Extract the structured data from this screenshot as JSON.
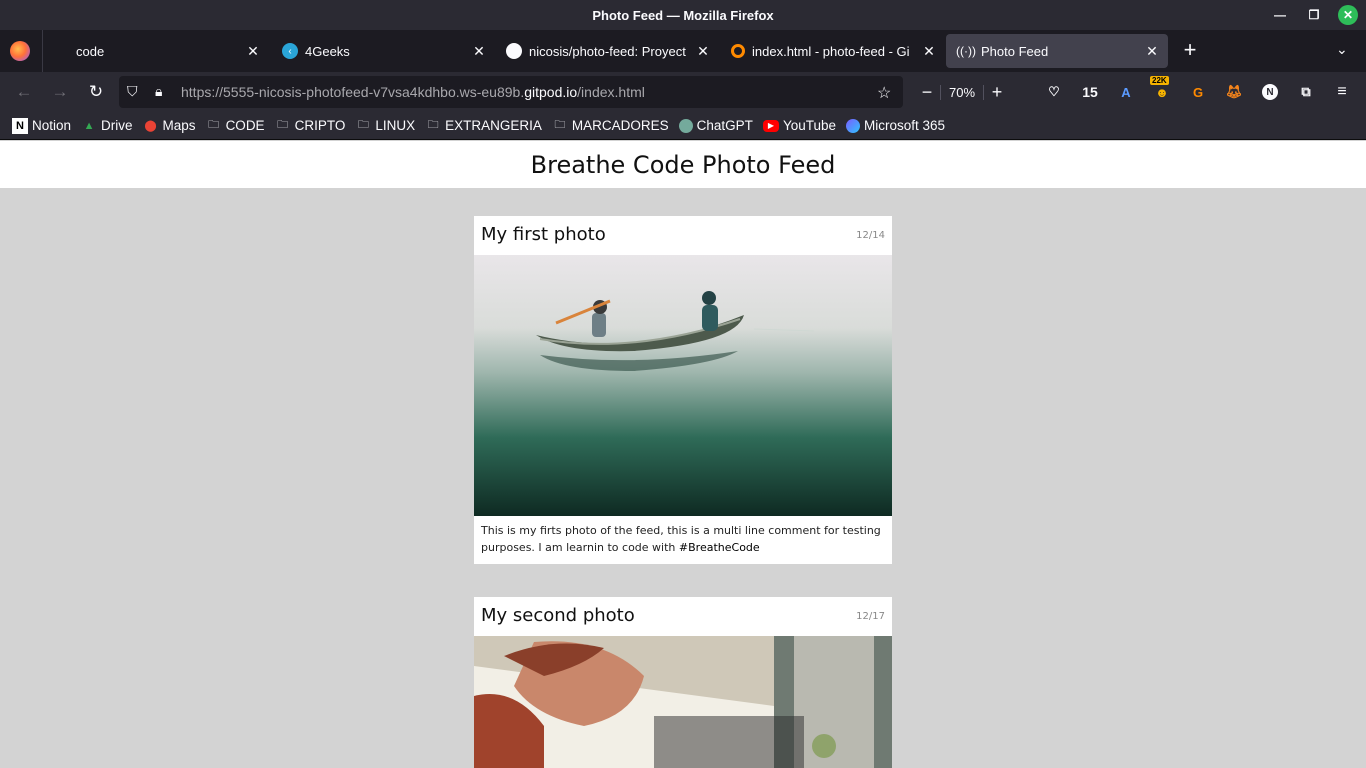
{
  "window": {
    "title": "Photo Feed — Mozilla Firefox"
  },
  "tabs": [
    {
      "label": "code",
      "icon": "firefox-container-icon"
    },
    {
      "label": "4Geeks",
      "icon": "4geeks-icon"
    },
    {
      "label": "nicosis/photo-feed: Proyect",
      "icon": "github-icon"
    },
    {
      "label": "index.html - photo-feed - Gi",
      "icon": "gitpod-icon"
    },
    {
      "label": "Photo Feed",
      "icon": "broadcast-icon",
      "active": true
    }
  ],
  "navbar": {
    "url_prefix": "https://5555-nicosis-photofeed-v7vsa4kdhbo.ws-eu89b.",
    "url_host": "gitpod.io",
    "url_suffix": "/index.html",
    "zoom": "70%",
    "ext_count": "15",
    "ext_badge": "22K",
    "avatar_letter": "N"
  },
  "bookmarks": [
    {
      "label": "Notion",
      "icon": "notion-icon"
    },
    {
      "label": "Drive",
      "icon": "drive-icon"
    },
    {
      "label": "Maps",
      "icon": "maps-icon"
    },
    {
      "label": "CODE",
      "icon": "folder-icon"
    },
    {
      "label": "CRIPTO",
      "icon": "folder-icon"
    },
    {
      "label": "LINUX",
      "icon": "folder-icon"
    },
    {
      "label": "EXTRANGERIA",
      "icon": "folder-icon"
    },
    {
      "label": "MARCADORES",
      "icon": "folder-icon"
    },
    {
      "label": "ChatGPT",
      "icon": "chatgpt-icon"
    },
    {
      "label": "YouTube",
      "icon": "youtube-icon"
    },
    {
      "label": "Microsoft 365",
      "icon": "microsoft365-icon"
    }
  ],
  "page": {
    "header": "Breathe Code Photo Feed",
    "posts": [
      {
        "title": "My first photo",
        "date": "12/14",
        "caption": "This is my firts photo of the feed, this is a multi line comment for testing purposes. I am learnin to code with",
        "hashtag": "#BreatheCode"
      },
      {
        "title": "My second photo",
        "date": "12/17"
      }
    ]
  }
}
